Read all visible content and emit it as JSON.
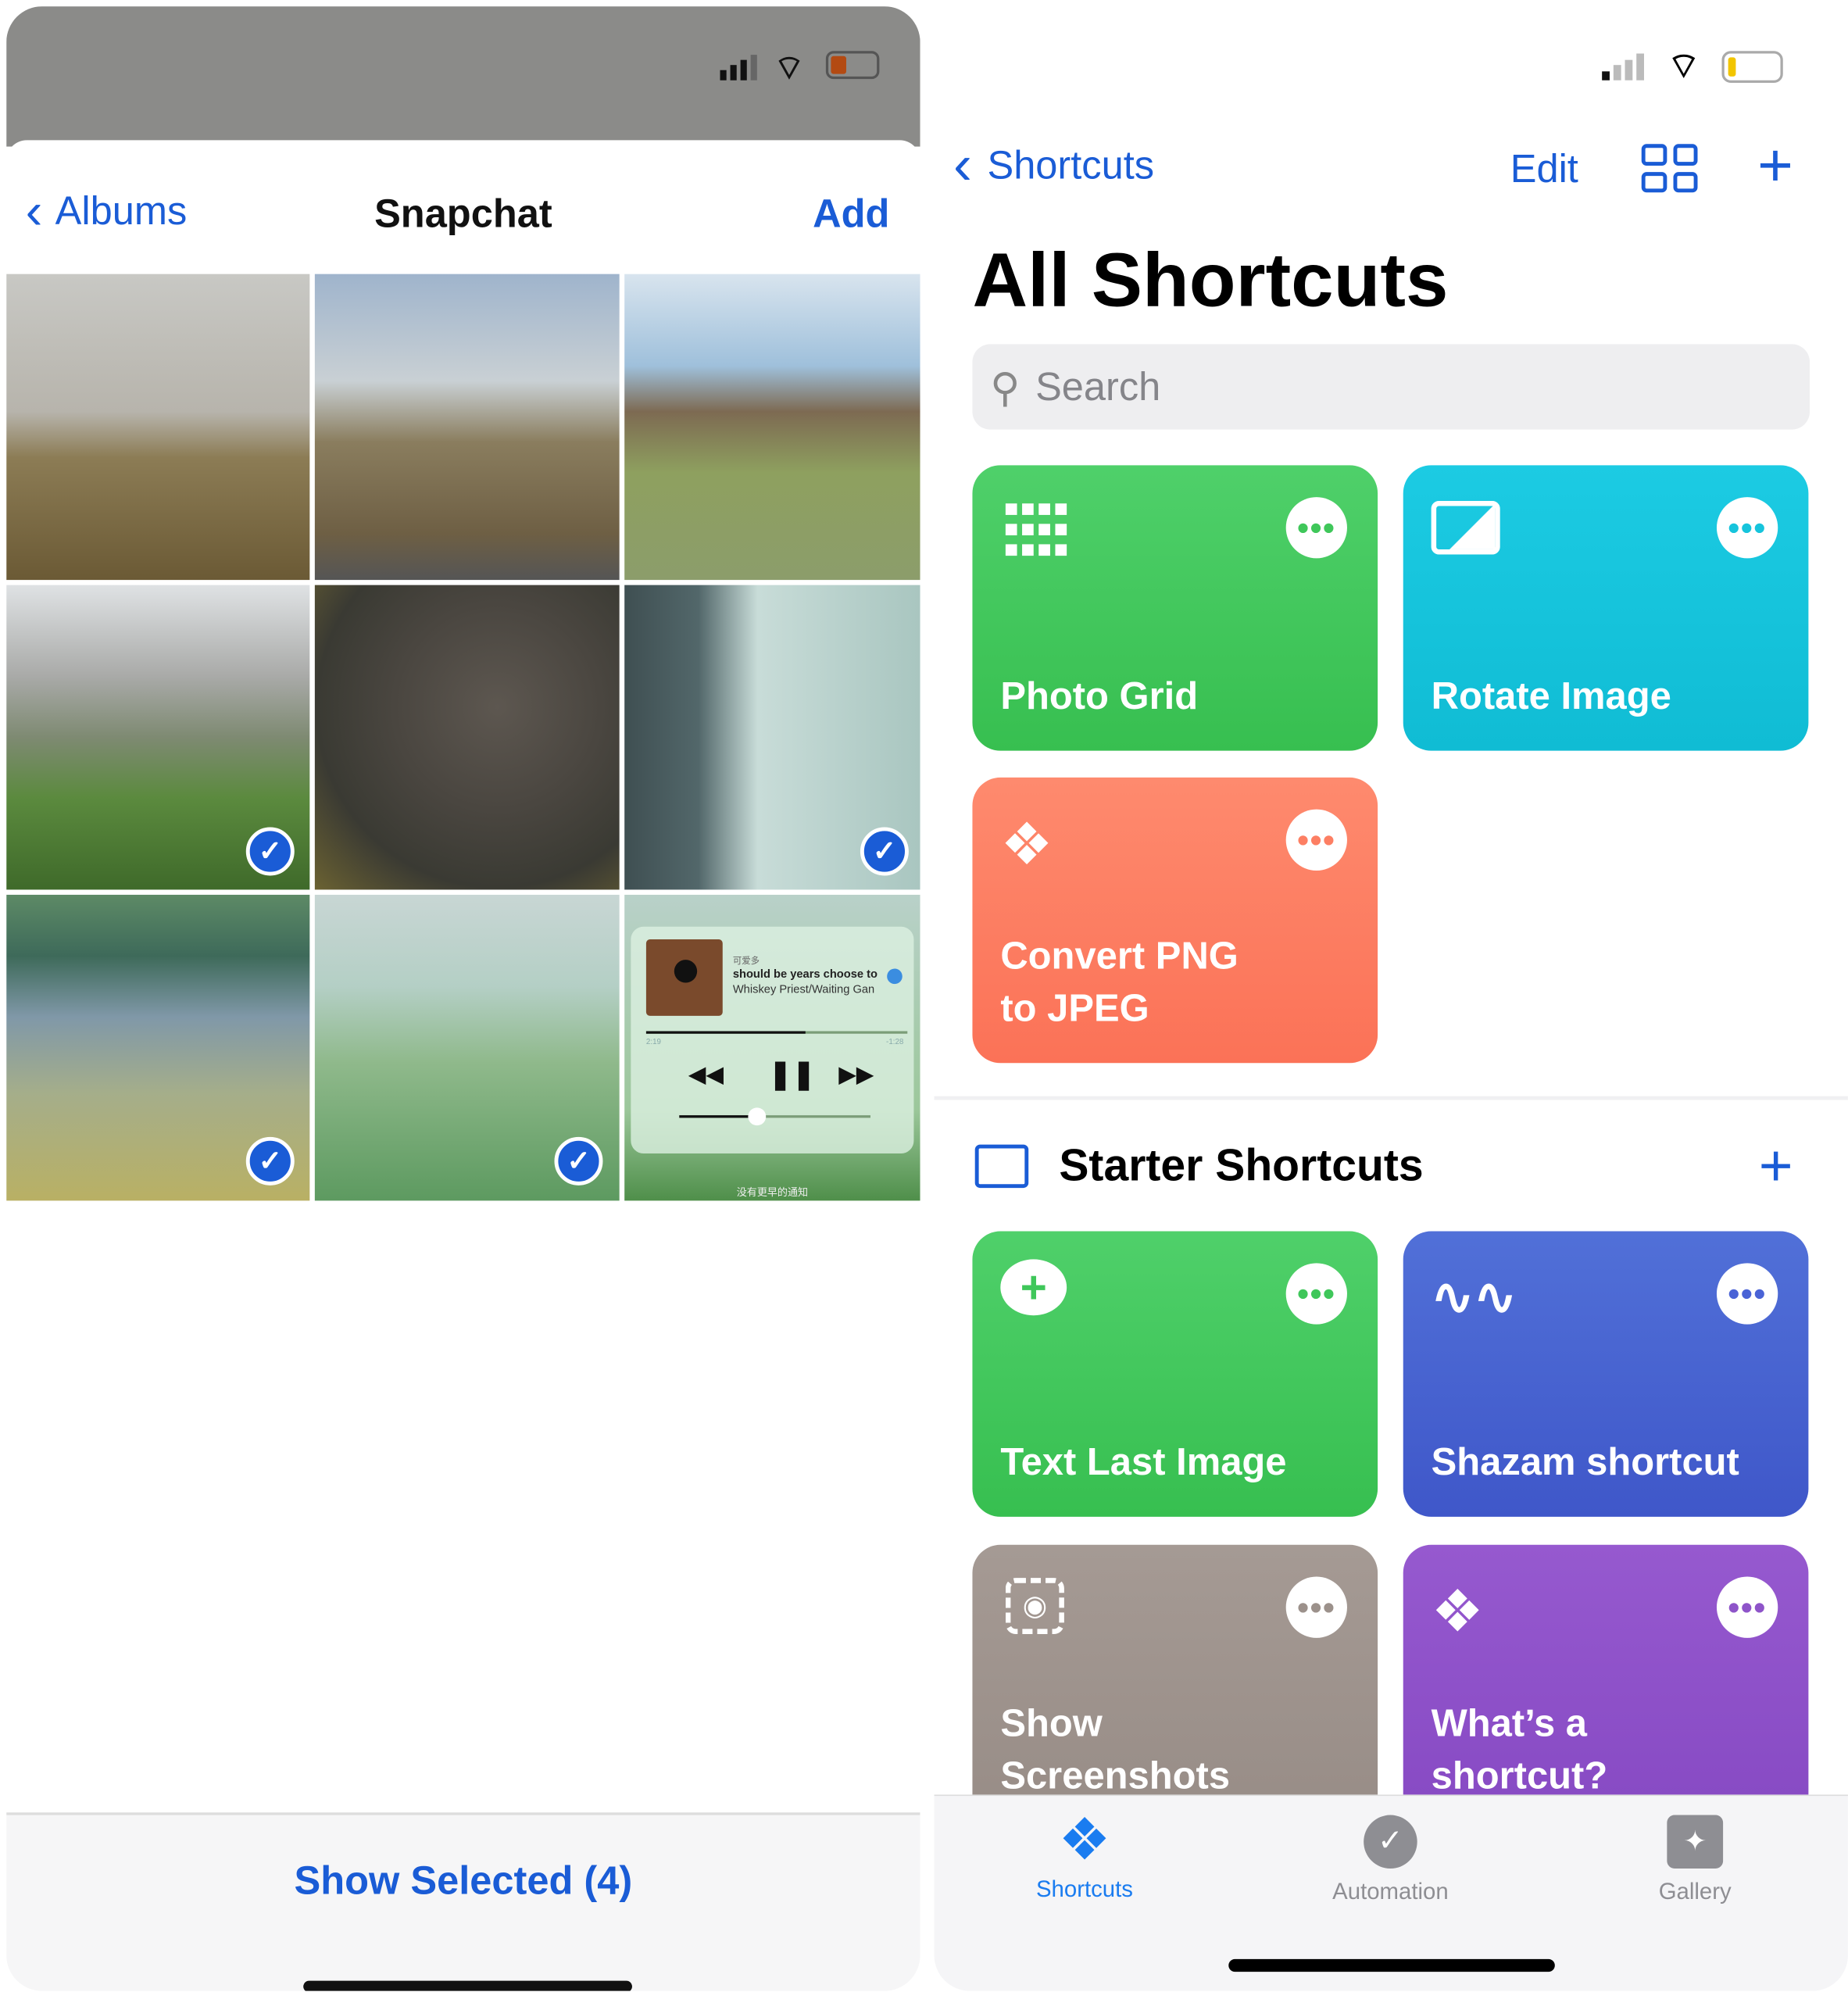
{
  "photos_picker": {
    "back_label": "Albums",
    "title": "Snapchat",
    "add_label": "Add",
    "show_selected_label": "Show Selected (4)",
    "photos": [
      {
        "scene": "rain on window, mountain",
        "selected": false
      },
      {
        "scene": "hillside road, cloudy sky",
        "selected": false
      },
      {
        "scene": "valley with grazing animals",
        "selected": false
      },
      {
        "scene": "alpine mountains meadow",
        "selected": true
      },
      {
        "scene": "car with fallen leaves",
        "selected": false
      },
      {
        "scene": "airplane window",
        "selected": true
      },
      {
        "scene": "painted river landscape",
        "selected": false
      },
      {
        "scene": "painted wheat field",
        "selected": true
      },
      {
        "scene": "music player screenshot",
        "selected": false
      }
    ],
    "music_widget": {
      "artist_cn": "可爱多",
      "song": "should be years choose to",
      "album": "Whiskey Priest/Waiting Gan",
      "elapsed": "2:19",
      "remaining": "-1:28",
      "progress": 0.61,
      "volume": 0.4,
      "footer_cn": "没有更早的通知"
    }
  },
  "shortcuts_app": {
    "back_label": "Shortcuts",
    "edit_label": "Edit",
    "title": "All Shortcuts",
    "search_placeholder": "Search",
    "shortcuts": [
      {
        "name": "Photo Grid",
        "color": "#3fc75a",
        "icon": "grid-icon"
      },
      {
        "name": "Rotate Image",
        "color": "#16c4dc",
        "icon": "photo-icon"
      },
      {
        "name": "Convert PNG to JPEG",
        "line1": "Convert PNG",
        "line2": "to JPEG",
        "color": "#fd7f63",
        "icon": "shortcuts-layers-icon"
      }
    ],
    "folder": {
      "name": "Starter Shortcuts"
    },
    "starter": [
      {
        "name": "Text Last Image",
        "color": "#3fc75a",
        "icon": "message-plus-icon"
      },
      {
        "name": "Shazam shortcut",
        "color": "#4a63d6",
        "icon": "waveform-icon"
      },
      {
        "name": "Show Screenshots",
        "line1": "Show",
        "line2": "Screenshots",
        "color": "#9c918b",
        "icon": "screenshot-icon"
      },
      {
        "name": "What's a shortcut?",
        "line1": "What’s a",
        "line2": "shortcut?",
        "color": "#8e54c9",
        "icon": "shortcuts-layers-icon"
      }
    ],
    "tabs": [
      {
        "label": "Shortcuts",
        "active": true
      },
      {
        "label": "Automation",
        "active": false
      },
      {
        "label": "Gallery",
        "active": false
      }
    ],
    "accent": "#1a5cd6"
  }
}
